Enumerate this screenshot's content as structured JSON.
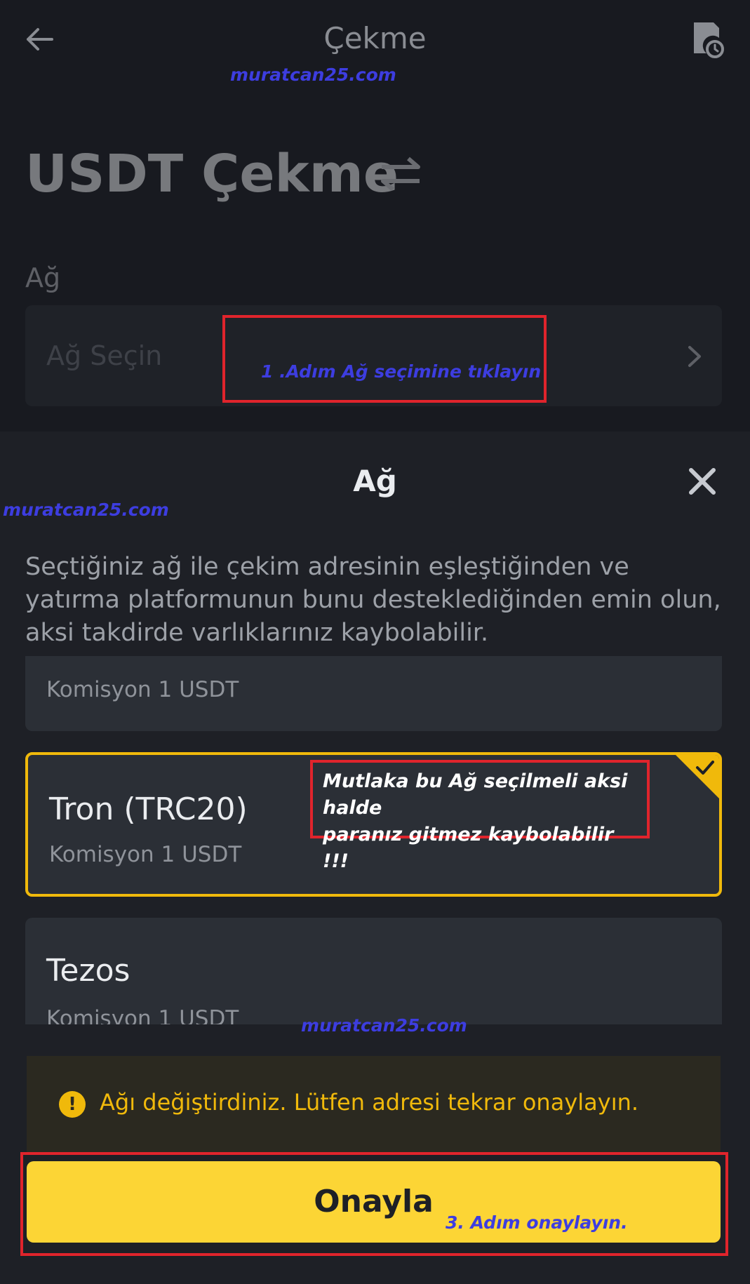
{
  "header": {
    "title": "Çekme",
    "back_icon": "arrow-left-icon",
    "history_icon": "history-doc-clock-icon"
  },
  "watermarks": [
    "muratcan25.com",
    "muratcan25.com",
    "muratcan25.com"
  ],
  "withdraw": {
    "title": "USDT Çekme",
    "swap_icon": "swap-arrows-icon"
  },
  "network_field": {
    "label": "Ağ",
    "placeholder": "Ağ Seçin"
  },
  "annotations": {
    "step1": "1 .Adım Ağ seçimine tıklayın",
    "note_line1": "Mutlaka bu Ağ seçilmeli aksi halde",
    "note_line2": "paranız gitmez kaybolabilir !!!",
    "step3": "3. Adım onaylayın."
  },
  "sheet": {
    "title": "Ağ",
    "description": "Seçtiğiniz ağ ile çekim adresinin eşleştiğinden ve yatırma platformunun bunu desteklediğinden emin olun, aksi takdirde varlıklarınız kaybolabilir.",
    "options": [
      {
        "name": "",
        "fee": "Komisyon 1 USDT",
        "selected": false
      },
      {
        "name": "Tron (TRC20)",
        "fee": "Komisyon 1 USDT",
        "selected": true
      },
      {
        "name": "Tezos",
        "fee": "Komisyon 1 USDT",
        "selected": false
      }
    ]
  },
  "alert": {
    "text": "Ağı değiştirdiniz. Lütfen adresi tekrar onaylayın."
  },
  "confirm_button": {
    "label": "Onayla"
  },
  "colors": {
    "accent": "#fcd535",
    "selected_border": "#f0b90b",
    "annotation_red": "#e0242c",
    "watermark_blue": "#3d3de0"
  }
}
